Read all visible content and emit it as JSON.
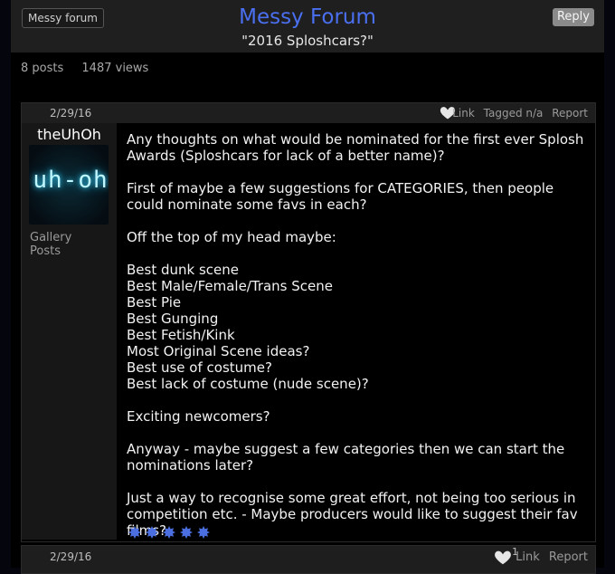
{
  "forum": {
    "breadcrumb": "Messy forum",
    "title": "Messy Forum",
    "thread_title": "\"2016 Sploshcars?\"",
    "reply_label": "Reply"
  },
  "stats": {
    "posts": "8 posts",
    "views": "1487 views"
  },
  "post": {
    "date": "2/29/16",
    "actions": {
      "link": "Link",
      "tagged": "Tagged n/a",
      "report": "Report"
    },
    "author": {
      "username": "theUhOh",
      "avatar_text": "uh-oh",
      "gallery": "Gallery",
      "posts": "Posts"
    },
    "paragraphs": [
      "Any thoughts on what would be nominated for the first ever Splosh Awards (Sploshcars for lack of a better name)?",
      "First of maybe a few suggestions for CATEGORIES, then people could nominate some favs in each?",
      "Off the top of my head maybe:"
    ],
    "categories": [
      "Best dunk scene",
      "Best Male/Female/Trans Scene",
      "Best Pie",
      "Best Gunging",
      "Best Fetish/Kink",
      "Most Original Scene ideas?",
      "Best use of costume?",
      "Best lack of costume (nude scene)?"
    ],
    "closing": [
      "Exciting newcomers?",
      "Anyway - maybe suggest a few categories then we can start the nominations later?",
      "Just a way to recognise some great effort, not being too serious in competition etc. - Maybe producers would like to suggest their fav films?"
    ],
    "emoji_icon": "splat-icon",
    "emoji_color": "#4b6fe0"
  },
  "post2": {
    "date": "2/29/16",
    "like_count": "1",
    "link": "Link",
    "report": "Report"
  },
  "colors": {
    "accent": "#4a6ff0",
    "background": "#000000",
    "bar": "#1e1e1e"
  }
}
